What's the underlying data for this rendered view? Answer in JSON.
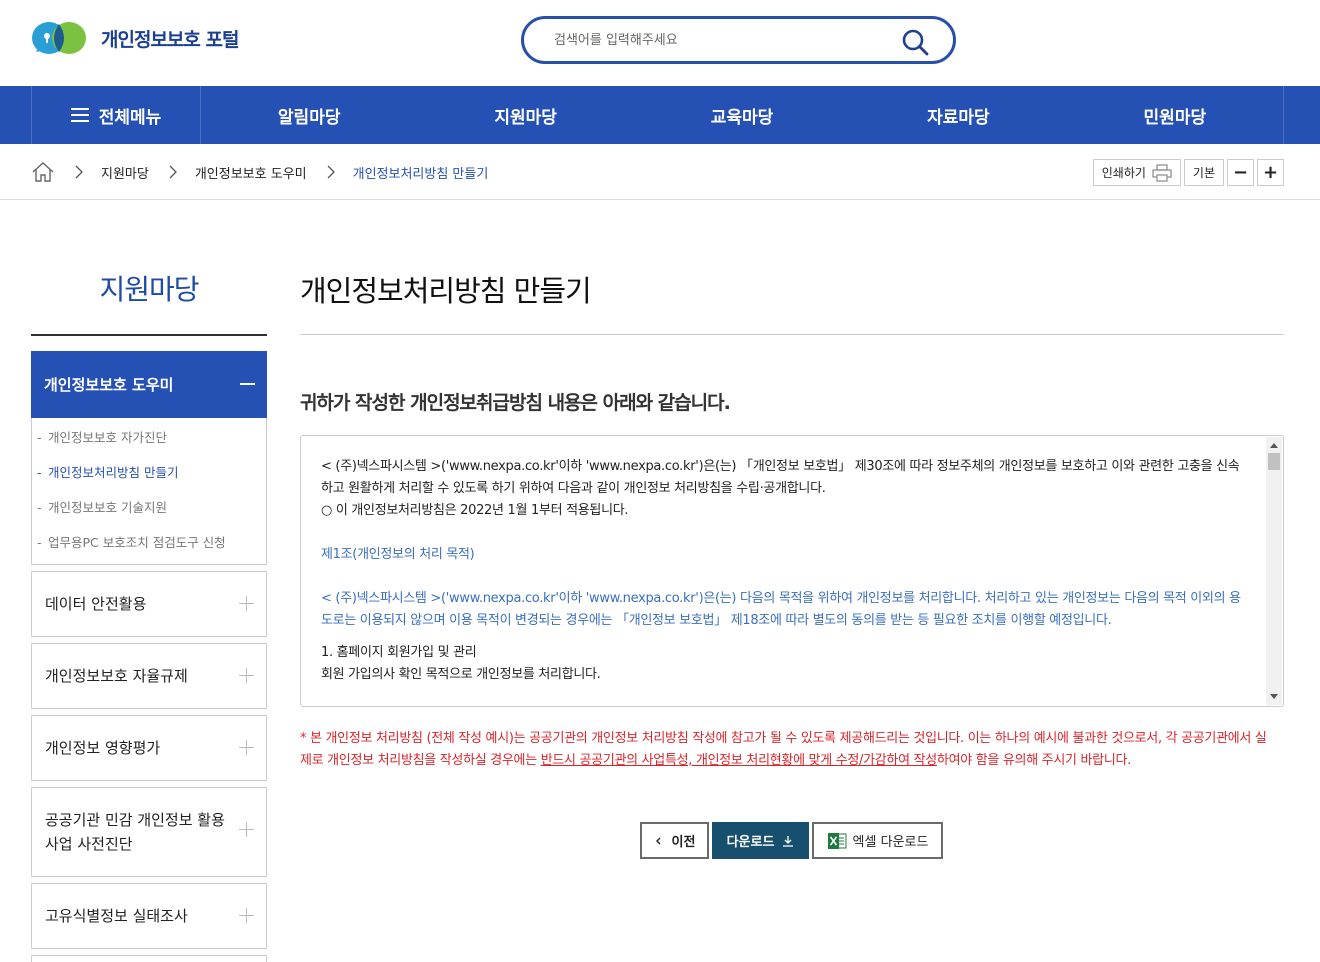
{
  "header": {
    "logo_text": "개인정보보호 포털",
    "search_placeholder": "검색어를 입력해주세요",
    "brand_color": "#2550b4"
  },
  "gnb": {
    "all_menu": "전체메뉴",
    "items": [
      "알림마당",
      "지원마당",
      "교육마당",
      "자료마당",
      "민원마당"
    ]
  },
  "breadcrumb": {
    "items": [
      "지원마당",
      "개인정보보호 도우미",
      "개인정보처리방침 만들기"
    ]
  },
  "tools": {
    "print": "인쇄하기",
    "default": "기본",
    "minus": "−",
    "plus": "+"
  },
  "lnb": {
    "title": "지원마당",
    "open_item": "개인정보보호 도우미",
    "sub_items": [
      "개인정보보호 자가진단",
      "개인정보처리방침 만들기",
      "개인정보보호 기술지원",
      "업무용PC 보호조치 점검도구 신청"
    ],
    "items": [
      "데이터 안전활용",
      "개인정보보호 자율규제",
      "개인정보 영향평가",
      "공공기관 민감 개인정보 활용사업 사전진단",
      "고유식별정보 실태조사"
    ]
  },
  "content": {
    "title": "개인정보처리방침 만들기",
    "subtitle": "귀하가 작성한 개인정보취급방침 내용은 아래와 같습니다.",
    "doc": {
      "p1": "< (주)넥스파시스템 >('www.nexpa.co.kr'이하 'www.nexpa.co.kr')은(는) 「개인정보 보호법」 제30조에 따라 정보주체의 개인정보를 보호하고 이와 관련한 고충을 신속하고 원활하게 처리할 수 있도록 하기 위하여 다음과 같이 개인정보 처리방침을 수립·공개합니다.",
      "p2": "○ 이 개인정보처리방침은 2022년 1월 1부터 적용됩니다.",
      "article1_title": "제1조(개인정보의 처리 목적)",
      "article1_body": "< (주)넥스파시스템 >('www.nexpa.co.kr'이하 'www.nexpa.co.kr')은(는) 다음의 목적을 위하여 개인정보를 처리합니다. 처리하고 있는 개인정보는 다음의 목적 이외의 용도로는 이용되지 않으며 이용 목적이 변경되는 경우에는 「개인정보 보호법」 제18조에 따라 별도의 동의를 받는 등 필요한 조치를 이행할 예정입니다.",
      "item1": "1. 홈페이지 회원가입 및 관리",
      "item1_body": "회원 가입의사 확인 목적으로 개인정보를 처리합니다."
    },
    "notice_a": "* 본 개인정보 처리방침 (전체 작성 예시)는 공공기관의 개인정보 처리방침 작성에 참고가 될 수 있도록 제공해드리는 것입니다. 이는 하나의 예시에 불과한 것으로서, 각 공공기관에서 실제로 개인정보 처리방침을 작성하실 경우에는 ",
    "notice_b": "반드시 공공기관의 사업특성, 개인정보 처리현황에 맞게 수정/가감하여 작성",
    "notice_c": "하여야 함을 유의해 주시기 바랍니다.",
    "buttons": {
      "prev": "이전",
      "download": "다운로드",
      "excel": "엑셀 다운로드"
    }
  }
}
